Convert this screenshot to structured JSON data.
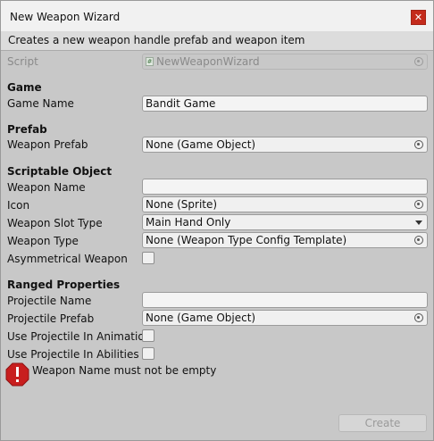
{
  "window": {
    "title": "New Weapon Wizard",
    "close_icon": "✕"
  },
  "description": "Creates a new weapon handle prefab and weapon item",
  "script": {
    "label": "Script",
    "value": "NewWeaponWizard",
    "icon": "#"
  },
  "sections": {
    "game": {
      "header": "Game",
      "game_name": {
        "label": "Game Name",
        "value": "Bandit Game"
      }
    },
    "prefab": {
      "header": "Prefab",
      "weapon_prefab": {
        "label": "Weapon Prefab",
        "value": "None (Game Object)"
      }
    },
    "scriptable_object": {
      "header": "Scriptable Object",
      "weapon_name": {
        "label": "Weapon Name",
        "value": ""
      },
      "icon": {
        "label": "Icon",
        "value": "None (Sprite)"
      },
      "weapon_slot_type": {
        "label": "Weapon Slot Type",
        "value": "Main Hand Only"
      },
      "weapon_type": {
        "label": "Weapon Type",
        "value": "None (Weapon Type Config Template)"
      },
      "asymmetrical_weapon": {
        "label": "Asymmetrical Weapon",
        "checked": false
      }
    },
    "ranged": {
      "header": "Ranged Properties",
      "projectile_name": {
        "label": "Projectile Name",
        "value": ""
      },
      "projectile_prefab": {
        "label": "Projectile Prefab",
        "value": "None (Game Object)"
      },
      "use_projectile_in_animation": {
        "label": "Use Projectile In Animation",
        "checked": false
      },
      "use_projectile_in_abilities": {
        "label": "Use Projectile In Abilities",
        "checked": false
      }
    }
  },
  "help": {
    "message": "Weapon Name must not be empty",
    "icon": "error-icon"
  },
  "buttons": {
    "create": "Create"
  },
  "colors": {
    "accent_close": "#c42b1c",
    "error": "#c81e1e"
  }
}
